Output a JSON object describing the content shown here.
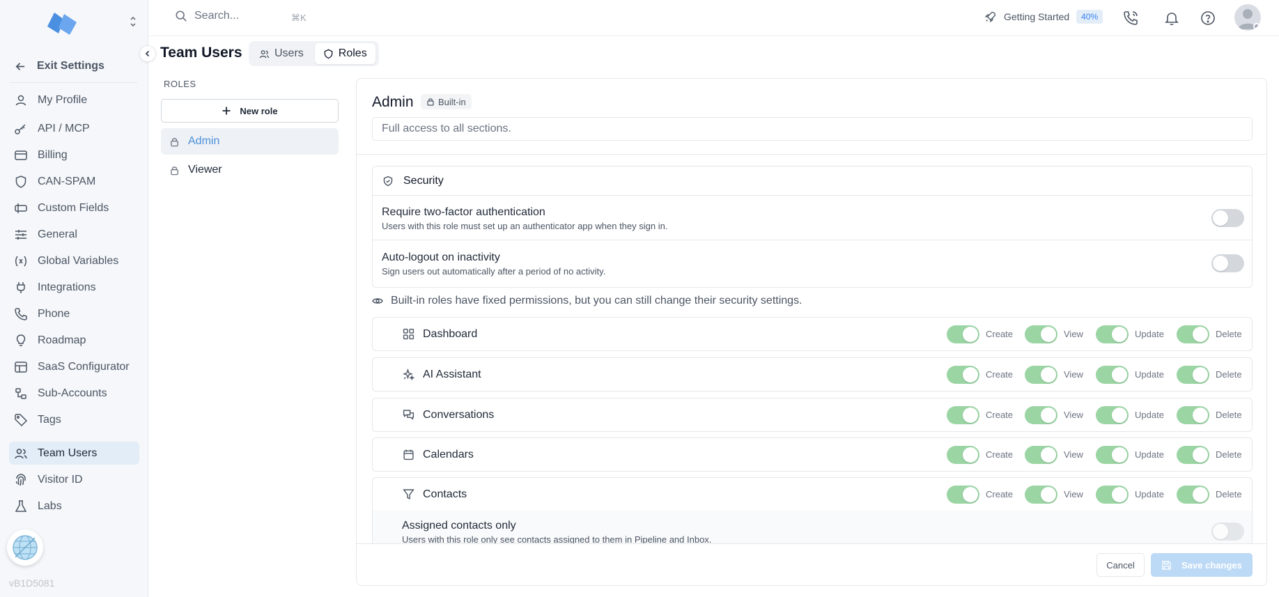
{
  "topbar": {
    "search_placeholder": "Search...",
    "search_shortcut": "⌘K",
    "getting_started_label": "Getting Started",
    "getting_started_progress": "40%"
  },
  "sidebar": {
    "exit_label": "Exit Settings",
    "version": "vB1D5081",
    "items": [
      {
        "label": "My Profile",
        "icon": "user-icon"
      },
      {
        "label": "API / MCP",
        "icon": "key-icon"
      },
      {
        "label": "Billing",
        "icon": "credit-card-icon"
      },
      {
        "label": "CAN-SPAM",
        "icon": "shield-icon"
      },
      {
        "label": "Custom Fields",
        "icon": "tag-field-icon"
      },
      {
        "label": "General",
        "icon": "sliders-icon"
      },
      {
        "label": "Global Variables",
        "icon": "variable-icon"
      },
      {
        "label": "Integrations",
        "icon": "plug-icon"
      },
      {
        "label": "Phone",
        "icon": "phone-icon"
      },
      {
        "label": "Roadmap",
        "icon": "lightbulb-icon"
      },
      {
        "label": "SaaS Configurator",
        "icon": "layout-icon"
      },
      {
        "label": "Sub-Accounts",
        "icon": "sub-accounts-icon"
      },
      {
        "label": "Tags",
        "icon": "tag-icon"
      },
      {
        "label": "Team Users",
        "icon": "users-icon",
        "active": true
      },
      {
        "label": "Visitor ID",
        "icon": "fingerprint-icon"
      },
      {
        "label": "Labs",
        "icon": "flask-icon"
      }
    ]
  },
  "header": {
    "title": "Team Users",
    "tabs": [
      {
        "label": "Users",
        "active": false
      },
      {
        "label": "Roles",
        "active": true
      }
    ]
  },
  "roles": {
    "section_label": "ROLES",
    "new_role_label": "New role",
    "items": [
      {
        "label": "Admin",
        "active": true
      },
      {
        "label": "Viewer",
        "active": false
      }
    ]
  },
  "editor": {
    "role_name": "Admin",
    "badge": "Built-in",
    "description": "Full access to all sections.",
    "security": {
      "heading": "Security",
      "rows": [
        {
          "title": "Require two-factor authentication",
          "subtitle": "Users with this role must set up an authenticator app when they sign in.",
          "enabled": false
        },
        {
          "title": "Auto-logout on inactivity",
          "subtitle": "Sign users out automatically after a period of no activity.",
          "enabled": false
        }
      ]
    },
    "note": "Built-in roles have fixed permissions, but you can still change their security settings.",
    "permission_labels": {
      "create": "Create",
      "view": "View",
      "update": "Update",
      "delete": "Delete"
    },
    "permissions": [
      {
        "name": "Dashboard",
        "icon": "dashboard-icon",
        "create": true,
        "view": true,
        "update": true,
        "delete": true
      },
      {
        "name": "AI Assistant",
        "icon": "sparkles-icon",
        "create": true,
        "view": true,
        "update": true,
        "delete": true
      },
      {
        "name": "Conversations",
        "icon": "chat-icon",
        "create": true,
        "view": true,
        "update": true,
        "delete": true
      },
      {
        "name": "Calendars",
        "icon": "calendar-icon",
        "create": true,
        "view": true,
        "update": true,
        "delete": true
      },
      {
        "name": "Contacts",
        "icon": "filter-icon",
        "create": true,
        "view": true,
        "update": true,
        "delete": true
      }
    ],
    "contacts_option": {
      "title": "Assigned contacts only",
      "subtitle": "Users with this role only see contacts assigned to them in Pipeline and Inbox.",
      "enabled": false
    },
    "footer": {
      "cancel": "Cancel",
      "save": "Save changes"
    }
  },
  "colors": {
    "accent": "#4a90d9",
    "toggle_on": "#9bd5a4",
    "toggle_off": "#d4d8dd",
    "save_disabled": "#bcd9f6"
  }
}
